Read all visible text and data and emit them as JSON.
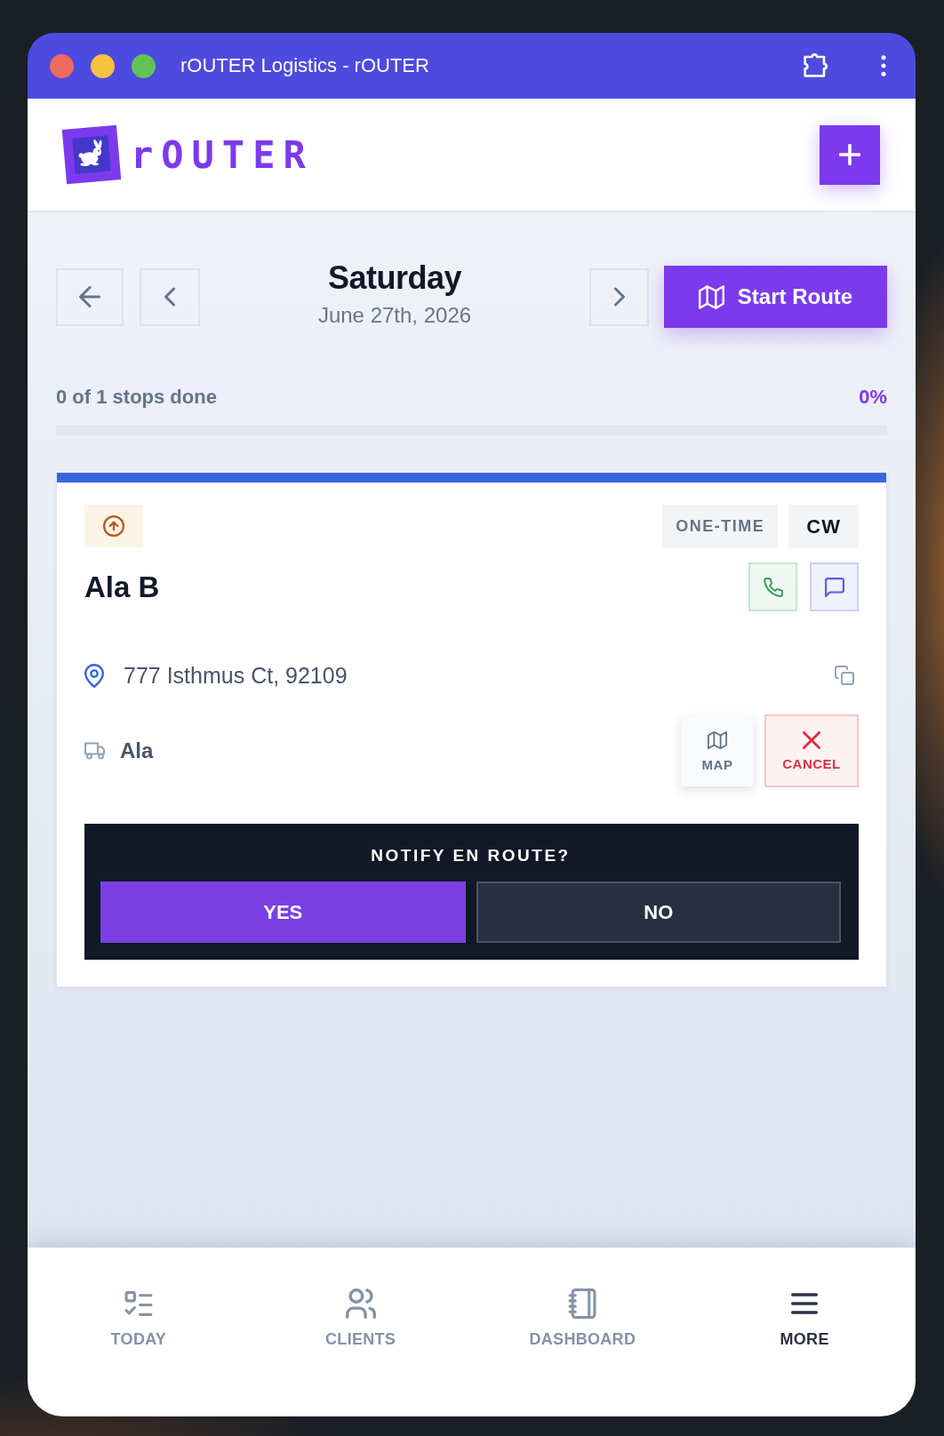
{
  "window": {
    "title": "rOUTER Logistics - rOUTER"
  },
  "header": {
    "logo_text": "rOUTER"
  },
  "day": {
    "weekday": "Saturday",
    "date": "June 27th, 2026",
    "start_button": "Start Route"
  },
  "progress": {
    "label": "0 of 1 stops done",
    "percent": "0%"
  },
  "stops": [
    {
      "color": "#3b66e0",
      "tags": [
        {
          "kind": "schedule",
          "text": "ONE-TIME"
        },
        {
          "kind": "initials",
          "text": "CW"
        }
      ],
      "name": "Ala B",
      "address": "777 Isthmus Ct, 92109",
      "driver": "Ala",
      "actions": [
        {
          "kind": "map",
          "label": "MAP"
        },
        {
          "kind": "cancel",
          "label": "CANCEL"
        }
      ],
      "notify": {
        "question": "NOTIFY EN ROUTE?",
        "options": [
          {
            "label": "YES",
            "selected": true
          },
          {
            "label": "NO",
            "selected": false
          }
        ]
      }
    }
  ],
  "bottom_nav": [
    {
      "label": "TODAY",
      "selected": false
    },
    {
      "label": "CLIENTS",
      "selected": false
    },
    {
      "label": "DASHBOARD",
      "selected": false
    },
    {
      "label": "MORE",
      "selected": true
    }
  ]
}
